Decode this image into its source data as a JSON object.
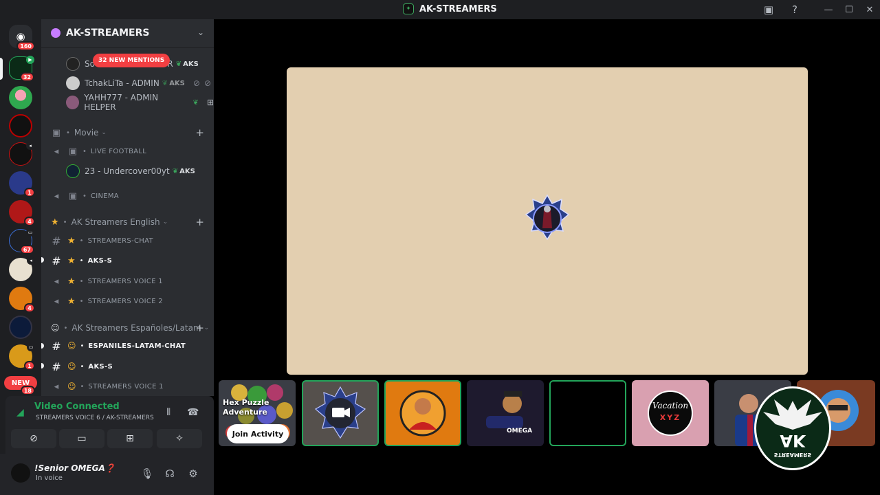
{
  "window": {
    "title": "AK-STREAMERS"
  },
  "guilds": {
    "dm_badge": "160",
    "items": [
      {
        "badge": "32"
      },
      {
        "badge": ""
      },
      {
        "badge": ""
      },
      {
        "badge": ""
      },
      {
        "badge": "1"
      },
      {
        "badge": "4"
      },
      {
        "badge": "67"
      },
      {
        "badge": ""
      },
      {
        "badge": "4"
      },
      {
        "badge": ""
      },
      {
        "badge": "1"
      }
    ],
    "new_label": "NEW",
    "last_badge": "18"
  },
  "server": {
    "name": "AK-STREAMERS",
    "mentions_label": "32 NEW MENTIONS"
  },
  "channel_list": {
    "voice_users_top": [
      {
        "name": "So",
        "name_tail": "OR",
        "tag": "AKS"
      },
      {
        "name": "TchakLiTa - ADMIN",
        "tag": "AKS"
      },
      {
        "name": "YAHH777 - ADMIN HELPER",
        "tag": ""
      }
    ],
    "movie_category": "Movie",
    "live_football": "LIVE FOOTBALL",
    "football_user": {
      "name": "23 - Undercover00yt",
      "tag": "AKS"
    },
    "cinema": "CINEMA",
    "english_category": "AK Streamers English",
    "streamers_chat": "STREAMERS-CHAT",
    "aks_s_1": "AKS-S",
    "streamers_voice_1": "STREAMERS VOICE 1",
    "streamers_voice_2": "STREAMERS VOICE 2",
    "spanish_category": "AK Streamers Españoles/Latam",
    "espaniles_chat": "ESPANILES-LATAM-CHAT",
    "aks_s_2": "AKS-S",
    "streamers_voice_1b": "STREAMERS VOICE 1"
  },
  "voice_panel": {
    "status": "Video Connected",
    "location": "STREAMERS VOICE 6 / AK-STREAMERS"
  },
  "user_panel": {
    "name": "!Senior OMEGA❓",
    "status": "In voice"
  },
  "activity_tile": {
    "title": "Hex Puzzle Adventure",
    "join_label": "Join Activity"
  },
  "vacation_tile": {
    "text": "Vacation",
    "sub": "XYZ"
  },
  "ak_overlay": {
    "text": "AK",
    "sub": "STREAMERS"
  },
  "colors": {
    "accent_green": "#23a55a",
    "mention_red": "#f23f42",
    "screen_bg": "#e3cfb0"
  }
}
